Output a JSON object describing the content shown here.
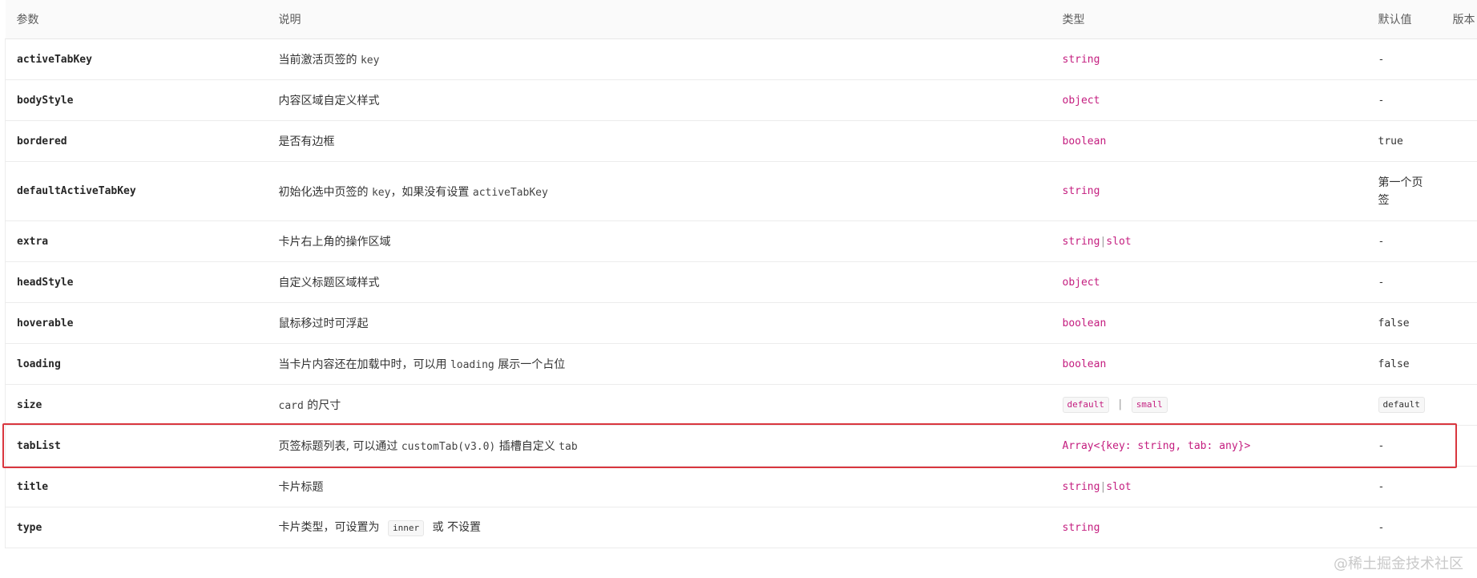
{
  "table": {
    "columns": [
      "参数",
      "说明",
      "类型",
      "默认值",
      "版本"
    ],
    "rows": [
      {
        "param": "activeTabKey",
        "desc_pre": "当前激活页签的 ",
        "desc_code": "key",
        "type": "string",
        "default": "-"
      },
      {
        "param": "bodyStyle",
        "desc": "内容区域自定义样式",
        "type": "object",
        "default": "-"
      },
      {
        "param": "bordered",
        "desc": "是否有边框",
        "type": "boolean",
        "default": "true"
      },
      {
        "param": "defaultActiveTabKey",
        "desc_pre": "初始化选中页签的 ",
        "desc_code": "key",
        "desc_mid": "，如果没有设置 ",
        "desc_code2": "activeTabKey",
        "type": "string",
        "default": "第一个页签"
      },
      {
        "param": "extra",
        "desc": "卡片右上角的操作区域",
        "type_a": "string",
        "type_sep": "|",
        "type_b": "slot",
        "default": "-"
      },
      {
        "param": "headStyle",
        "desc": "自定义标题区域样式",
        "type": "object",
        "default": "-"
      },
      {
        "param": "hoverable",
        "desc": "鼠标移过时可浮起",
        "type": "boolean",
        "default": "false"
      },
      {
        "param": "loading",
        "desc_pre": "当卡片内容还在加载中时，可以用 ",
        "desc_code": "loading",
        "desc_post": " 展示一个占位",
        "type": "boolean",
        "default": "false"
      },
      {
        "param": "size",
        "desc_code": "card",
        "desc_post": " 的尺寸",
        "type_tag_a": "default",
        "type_sep": "|",
        "type_tag_b": "small",
        "default_tag": "default"
      },
      {
        "param": "tabList",
        "desc_pre": "页签标题列表, 可以通过 ",
        "desc_code": "customTab(v3.0)",
        "desc_post": " 插槽自定义 ",
        "desc_code2": "tab",
        "type": "Array<{key: string, tab: any}>",
        "default": "-"
      },
      {
        "param": "title",
        "desc": "卡片标题",
        "type_a": "string",
        "type_sep": "|",
        "type_b": "slot",
        "default": "-"
      },
      {
        "param": "type",
        "desc_pre": "卡片类型，可设置为 ",
        "desc_tag": "inner",
        "desc_post": " 或 不设置",
        "type": "string",
        "default": "-"
      }
    ]
  },
  "watermark": "@稀土掘金技术社区",
  "colors": {
    "type_text": "#c41d7f",
    "highlight_border": "#d9363e",
    "header_bg": "#fafafa"
  }
}
